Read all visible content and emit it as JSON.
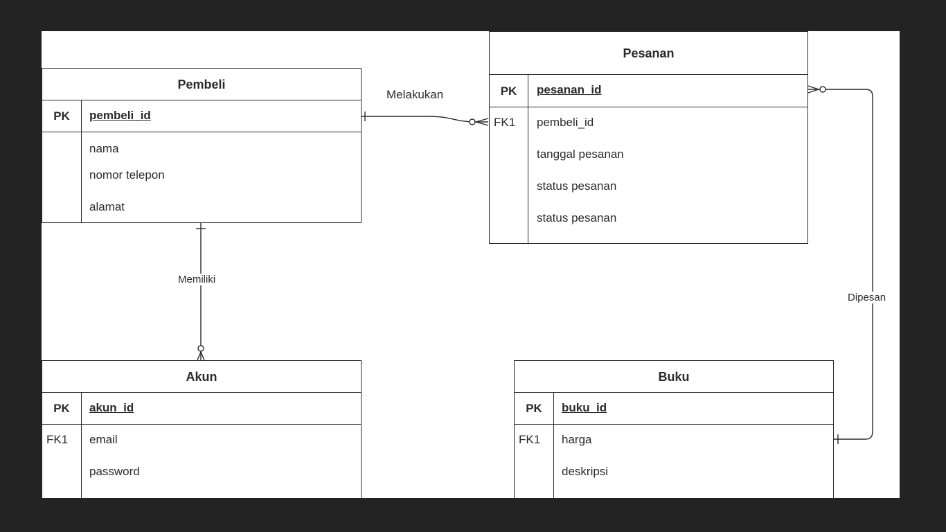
{
  "entities": {
    "pembeli": {
      "title": "Pembeli",
      "pk_label": "PK",
      "pk_attr": "pembeli_id",
      "attrs": [
        {
          "key": "",
          "name": "nama"
        },
        {
          "key": "",
          "name": "nomor telepon"
        },
        {
          "key": "",
          "name": "alamat"
        }
      ]
    },
    "pesanan": {
      "title": "Pesanan",
      "pk_label": "PK",
      "pk_attr": "pesanan_id",
      "attrs": [
        {
          "key": "FK1",
          "name": "pembeli_id"
        },
        {
          "key": "",
          "name": "tanggal pesanan"
        },
        {
          "key": "",
          "name": "status pesanan"
        },
        {
          "key": "",
          "name": "status pesanan"
        }
      ]
    },
    "akun": {
      "title": "Akun",
      "pk_label": "PK",
      "pk_attr": "akun_id",
      "attrs": [
        {
          "key": "FK1",
          "name": "email"
        },
        {
          "key": "",
          "name": "password"
        }
      ]
    },
    "buku": {
      "title": "Buku",
      "pk_label": "PK",
      "pk_attr": "buku_id",
      "attrs": [
        {
          "key": "FK1",
          "name": "harga"
        },
        {
          "key": "",
          "name": "deskripsi"
        }
      ]
    }
  },
  "relationships": {
    "melakukan": "Melakukan",
    "memiliki": "Memiliki",
    "dipesan": "Dipesan"
  },
  "colors": {
    "frame": "#232323",
    "canvas": "#ffffff",
    "line": "#2a2a2a"
  }
}
